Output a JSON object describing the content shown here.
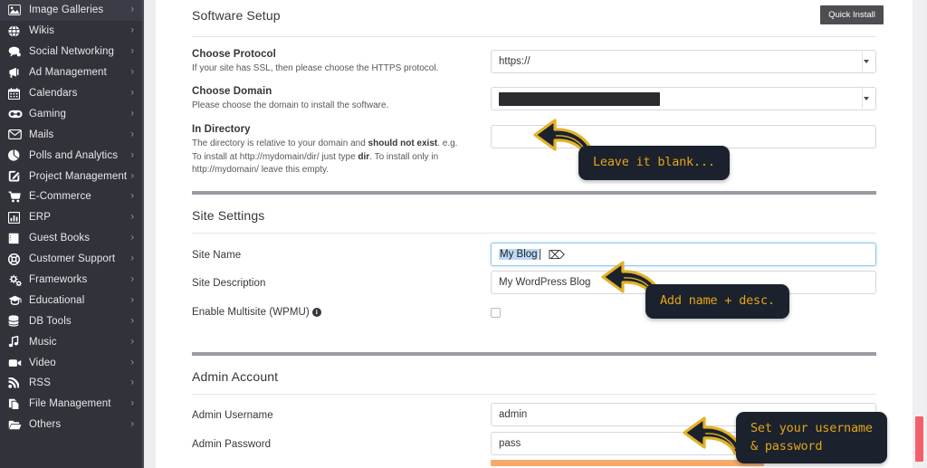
{
  "sidebar": {
    "items": [
      {
        "label": "Image Galleries",
        "icon": "image-icon"
      },
      {
        "label": "Wikis",
        "icon": "globe-icon"
      },
      {
        "label": "Social Networking",
        "icon": "chat-bubble-icon"
      },
      {
        "label": "Ad Management",
        "icon": "megaphone-icon"
      },
      {
        "label": "Calendars",
        "icon": "calendar-icon"
      },
      {
        "label": "Gaming",
        "icon": "gamepad-icon"
      },
      {
        "label": "Mails",
        "icon": "envelope-icon"
      },
      {
        "label": "Polls and Analytics",
        "icon": "pie-chart-icon"
      },
      {
        "label": "Project Management",
        "icon": "pencil-square-icon"
      },
      {
        "label": "E-Commerce",
        "icon": "shopping-cart-icon"
      },
      {
        "label": "ERP",
        "icon": "bar-chart-icon"
      },
      {
        "label": "Guest Books",
        "icon": "book-icon"
      },
      {
        "label": "Customer Support",
        "icon": "lifebuoy-icon"
      },
      {
        "label": "Frameworks",
        "icon": "gears-icon"
      },
      {
        "label": "Educational",
        "icon": "graduation-cap-icon"
      },
      {
        "label": "DB Tools",
        "icon": "database-icon"
      },
      {
        "label": "Music",
        "icon": "music-note-icon"
      },
      {
        "label": "Video",
        "icon": "video-camera-icon"
      },
      {
        "label": "RSS",
        "icon": "rss-icon"
      },
      {
        "label": "File Management",
        "icon": "files-icon"
      },
      {
        "label": "Others",
        "icon": "folder-open-icon"
      }
    ],
    "caret": "›"
  },
  "software_setup": {
    "title": "Software Setup",
    "quick_install_label": "Quick Install",
    "protocol": {
      "label": "Choose Protocol",
      "help": "If your site has SSL, then please choose the HTTPS protocol.",
      "value": "https://"
    },
    "domain": {
      "label": "Choose Domain",
      "help": "Please choose the domain to install the software.",
      "value": ""
    },
    "directory": {
      "label": "In Directory",
      "help_pre": "The directory is relative to your domain and ",
      "help_b1": "should not exist",
      "help_mid": ". e.g. To install at http://mydomain/dir/ just type ",
      "help_b2": "dir",
      "help_post": ". To install only in http://mydomain/ leave this empty.",
      "value": ""
    }
  },
  "site_settings": {
    "title": "Site Settings",
    "site_name": {
      "label": "Site Name",
      "value": "My Blog"
    },
    "site_description": {
      "label": "Site Description",
      "value": "My WordPress Blog"
    },
    "multisite": {
      "label": "Enable Multisite (WPMU)",
      "info_glyph": "i",
      "checked": false
    }
  },
  "admin_account": {
    "title": "Admin Account",
    "username": {
      "label": "Admin Username",
      "value": "admin"
    },
    "password": {
      "label": "Admin Password",
      "value": "pass"
    }
  },
  "callouts": {
    "one": "Leave it blank...",
    "two": "Add name + desc.",
    "three": "Set your username\n& password"
  },
  "colors": {
    "sidebar_bg": "#32323a",
    "callout_bg": "#1b222e",
    "callout_text": "#e5a417",
    "arrow_gold": "#e3b229",
    "scrollbar_thumb": "#f4606a",
    "password_meter": "#f6a96a",
    "focus_border": "#94c8ea"
  }
}
